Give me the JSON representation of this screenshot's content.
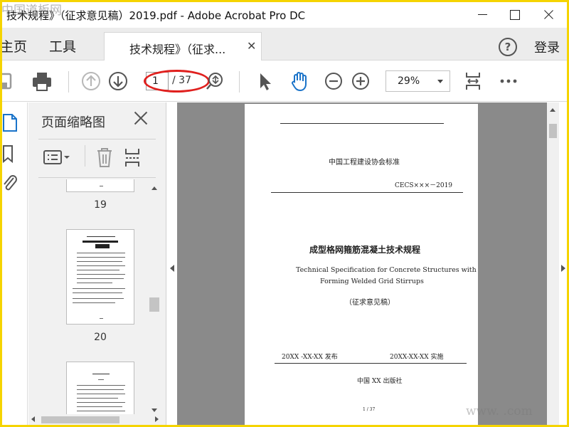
{
  "window": {
    "title": "技术规程》（征求意见稿）2019.pdf - Adobe Acrobat Pro DC"
  },
  "tabs": {
    "home": "主页",
    "tools": "工具",
    "document": "技术规程》（征求...",
    "login": "登录",
    "help": "?"
  },
  "toolbar": {
    "page_current": "1",
    "page_total": "/ 37",
    "zoom": "29%"
  },
  "thumbnail_panel": {
    "title": "页面缩略图",
    "pages": [
      {
        "label": "19"
      },
      {
        "label": "20"
      },
      {
        "label": ""
      }
    ]
  },
  "document": {
    "org": "中国工程建设协会标准",
    "code": "CECS×××－2019",
    "title_cn": "成型格网箍筋混凝土技术规程",
    "title_en_1": "Technical Specification for Concrete Structures with",
    "title_en_2": "Forming Welded Grid Stirrups",
    "draft": "（征求意见稿）",
    "publish": "20XX -XX-XX 发布",
    "implement": "20XX-XX-XX 实施",
    "publisher": "中国 XX 出版社",
    "page_num": "1 / 37"
  },
  "watermark": {
    "top": "中国道板网",
    "bottom": "www.    .com"
  },
  "colors": {
    "frame": "#f5d400",
    "annotation": "#e0201e",
    "hand_tool": "#1a73c9",
    "doc_background": "#8a8a8a"
  }
}
